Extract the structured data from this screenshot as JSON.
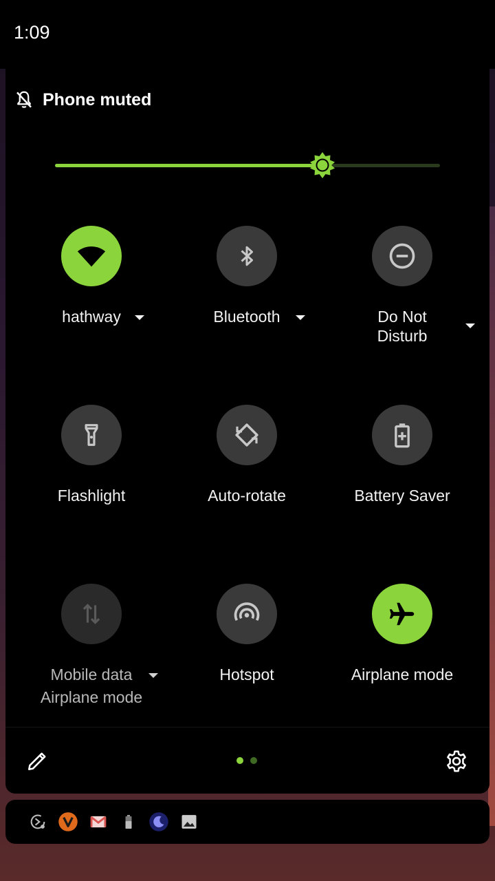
{
  "status_bar": {
    "time": "1:09"
  },
  "header": {
    "mute_text": "Phone muted",
    "mute_icon": "bell-off-icon"
  },
  "brightness": {
    "level_fraction": 0.695,
    "accent": "#8bd43c"
  },
  "tiles": [
    {
      "label": "hathway",
      "icon": "wifi-icon",
      "active": true,
      "has_menu": true
    },
    {
      "label": "Bluetooth",
      "icon": "bluetooth-icon",
      "active": false,
      "has_menu": true
    },
    {
      "label": "Do Not Disturb",
      "line1": "Do Not",
      "line2": "Disturb",
      "icon": "do-not-disturb-icon",
      "active": false,
      "has_menu": true
    },
    {
      "label": "Flashlight",
      "icon": "flashlight-icon",
      "active": false
    },
    {
      "label": "Auto-rotate",
      "icon": "auto-rotate-icon",
      "active": false
    },
    {
      "label": "Battery Saver",
      "icon": "battery-saver-icon",
      "active": false
    },
    {
      "label": "Mobile data",
      "sublabel": "Airplane mode",
      "icon": "mobile-data-icon",
      "active": false,
      "disabled": true,
      "has_menu": true
    },
    {
      "label": "Hotspot",
      "icon": "hotspot-icon",
      "active": false
    },
    {
      "label": "Airplane mode",
      "icon": "airplane-icon",
      "active": true
    }
  ],
  "footer": {
    "edit_icon": "pencil-icon",
    "settings_icon": "gear-icon",
    "pages": 2,
    "current_page": 1
  },
  "notifications": [
    "screen-recorder-icon",
    "v-app-icon",
    "gmail-icon",
    "battery-icon",
    "night-mode-icon",
    "image-icon"
  ],
  "colors": {
    "accent": "#8bd43c",
    "tile_bg": "#3a3a3a",
    "panel_bg": "#000000"
  }
}
